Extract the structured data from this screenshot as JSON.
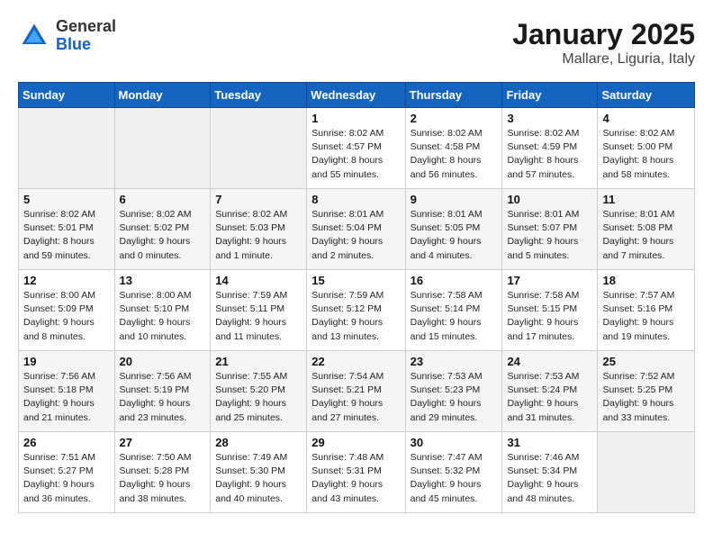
{
  "logo": {
    "general": "General",
    "blue": "Blue"
  },
  "calendar": {
    "title": "January 2025",
    "subtitle": "Mallare, Liguria, Italy"
  },
  "weekdays": [
    "Sunday",
    "Monday",
    "Tuesday",
    "Wednesday",
    "Thursday",
    "Friday",
    "Saturday"
  ],
  "weeks": [
    [
      {
        "day": "",
        "info": ""
      },
      {
        "day": "",
        "info": ""
      },
      {
        "day": "",
        "info": ""
      },
      {
        "day": "1",
        "info": "Sunrise: 8:02 AM\nSunset: 4:57 PM\nDaylight: 8 hours\nand 55 minutes."
      },
      {
        "day": "2",
        "info": "Sunrise: 8:02 AM\nSunset: 4:58 PM\nDaylight: 8 hours\nand 56 minutes."
      },
      {
        "day": "3",
        "info": "Sunrise: 8:02 AM\nSunset: 4:59 PM\nDaylight: 8 hours\nand 57 minutes."
      },
      {
        "day": "4",
        "info": "Sunrise: 8:02 AM\nSunset: 5:00 PM\nDaylight: 8 hours\nand 58 minutes."
      }
    ],
    [
      {
        "day": "5",
        "info": "Sunrise: 8:02 AM\nSunset: 5:01 PM\nDaylight: 8 hours\nand 59 minutes."
      },
      {
        "day": "6",
        "info": "Sunrise: 8:02 AM\nSunset: 5:02 PM\nDaylight: 9 hours\nand 0 minutes."
      },
      {
        "day": "7",
        "info": "Sunrise: 8:02 AM\nSunset: 5:03 PM\nDaylight: 9 hours\nand 1 minute."
      },
      {
        "day": "8",
        "info": "Sunrise: 8:01 AM\nSunset: 5:04 PM\nDaylight: 9 hours\nand 2 minutes."
      },
      {
        "day": "9",
        "info": "Sunrise: 8:01 AM\nSunset: 5:05 PM\nDaylight: 9 hours\nand 4 minutes."
      },
      {
        "day": "10",
        "info": "Sunrise: 8:01 AM\nSunset: 5:07 PM\nDaylight: 9 hours\nand 5 minutes."
      },
      {
        "day": "11",
        "info": "Sunrise: 8:01 AM\nSunset: 5:08 PM\nDaylight: 9 hours\nand 7 minutes."
      }
    ],
    [
      {
        "day": "12",
        "info": "Sunrise: 8:00 AM\nSunset: 5:09 PM\nDaylight: 9 hours\nand 8 minutes."
      },
      {
        "day": "13",
        "info": "Sunrise: 8:00 AM\nSunset: 5:10 PM\nDaylight: 9 hours\nand 10 minutes."
      },
      {
        "day": "14",
        "info": "Sunrise: 7:59 AM\nSunset: 5:11 PM\nDaylight: 9 hours\nand 11 minutes."
      },
      {
        "day": "15",
        "info": "Sunrise: 7:59 AM\nSunset: 5:12 PM\nDaylight: 9 hours\nand 13 minutes."
      },
      {
        "day": "16",
        "info": "Sunrise: 7:58 AM\nSunset: 5:14 PM\nDaylight: 9 hours\nand 15 minutes."
      },
      {
        "day": "17",
        "info": "Sunrise: 7:58 AM\nSunset: 5:15 PM\nDaylight: 9 hours\nand 17 minutes."
      },
      {
        "day": "18",
        "info": "Sunrise: 7:57 AM\nSunset: 5:16 PM\nDaylight: 9 hours\nand 19 minutes."
      }
    ],
    [
      {
        "day": "19",
        "info": "Sunrise: 7:56 AM\nSunset: 5:18 PM\nDaylight: 9 hours\nand 21 minutes."
      },
      {
        "day": "20",
        "info": "Sunrise: 7:56 AM\nSunset: 5:19 PM\nDaylight: 9 hours\nand 23 minutes."
      },
      {
        "day": "21",
        "info": "Sunrise: 7:55 AM\nSunset: 5:20 PM\nDaylight: 9 hours\nand 25 minutes."
      },
      {
        "day": "22",
        "info": "Sunrise: 7:54 AM\nSunset: 5:21 PM\nDaylight: 9 hours\nand 27 minutes."
      },
      {
        "day": "23",
        "info": "Sunrise: 7:53 AM\nSunset: 5:23 PM\nDaylight: 9 hours\nand 29 minutes."
      },
      {
        "day": "24",
        "info": "Sunrise: 7:53 AM\nSunset: 5:24 PM\nDaylight: 9 hours\nand 31 minutes."
      },
      {
        "day": "25",
        "info": "Sunrise: 7:52 AM\nSunset: 5:25 PM\nDaylight: 9 hours\nand 33 minutes."
      }
    ],
    [
      {
        "day": "26",
        "info": "Sunrise: 7:51 AM\nSunset: 5:27 PM\nDaylight: 9 hours\nand 36 minutes."
      },
      {
        "day": "27",
        "info": "Sunrise: 7:50 AM\nSunset: 5:28 PM\nDaylight: 9 hours\nand 38 minutes."
      },
      {
        "day": "28",
        "info": "Sunrise: 7:49 AM\nSunset: 5:30 PM\nDaylight: 9 hours\nand 40 minutes."
      },
      {
        "day": "29",
        "info": "Sunrise: 7:48 AM\nSunset: 5:31 PM\nDaylight: 9 hours\nand 43 minutes."
      },
      {
        "day": "30",
        "info": "Sunrise: 7:47 AM\nSunset: 5:32 PM\nDaylight: 9 hours\nand 45 minutes."
      },
      {
        "day": "31",
        "info": "Sunrise: 7:46 AM\nSunset: 5:34 PM\nDaylight: 9 hours\nand 48 minutes."
      },
      {
        "day": "",
        "info": ""
      }
    ]
  ]
}
